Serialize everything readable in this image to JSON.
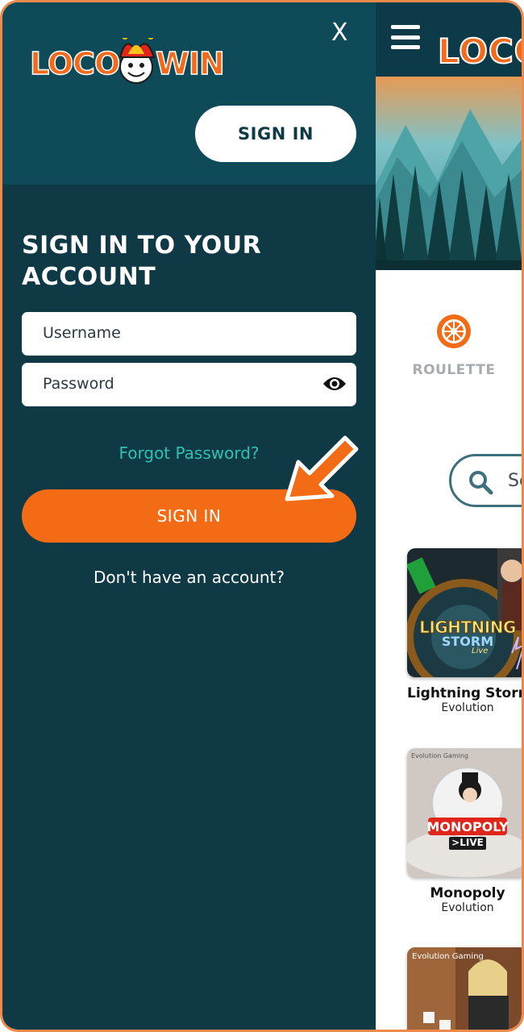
{
  "drawer": {
    "logo_left": "LOCO",
    "logo_right": "WIN",
    "close_label": "X",
    "top_signin_label": "SIGN IN",
    "form_title_line1": "SIGN IN TO YOUR",
    "form_title_line2": "ACCOUNT",
    "username_placeholder": "Username",
    "password_placeholder": "Password",
    "forgot_label": "Forgot Password?",
    "signin_label": "SIGN IN",
    "no_account_label": "Don't have an account?"
  },
  "background_page": {
    "logo_text": "LOCO",
    "category_label": "ROULETTE",
    "search_text": "Se",
    "games": [
      {
        "name": "Lightning Storm",
        "provider": "Evolution",
        "thumb_text_1": "LIGHTNING",
        "thumb_text_2": "STORM",
        "thumb_text_3": "Live"
      },
      {
        "name": "Monopoly",
        "provider": "Evolution",
        "thumb_text_1": "MONOPOLY",
        "thumb_text_2": ">LIVE",
        "thumb_text_3": "Evolution Gaming"
      },
      {
        "name": "",
        "provider": "",
        "thumb_text_1": "Evolution Gaming",
        "thumb_text_2": "",
        "thumb_text_3": ""
      }
    ]
  },
  "colors": {
    "drawer_bg": "#0e3945",
    "drawer_top_bg": "#0f4a58",
    "accent_orange": "#f36b14",
    "link_teal": "#2fc2b0",
    "frame_border": "#f08a4b"
  }
}
